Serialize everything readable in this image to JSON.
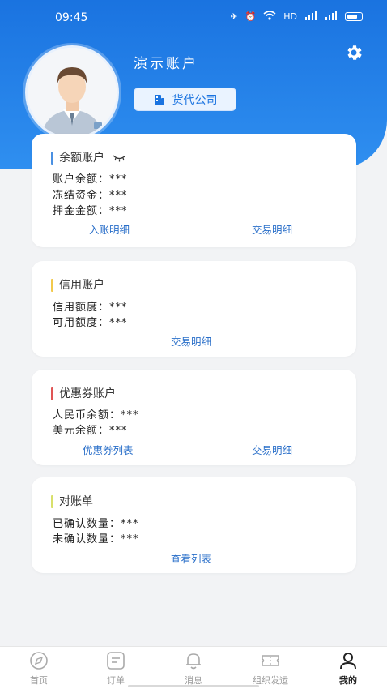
{
  "status_bar": {
    "time": "09:45",
    "net_label": "HD",
    "signal1": "4G",
    "signal2": "4G"
  },
  "profile": {
    "account_name": "演示账户",
    "company_label": "货代公司"
  },
  "balance_card": {
    "title": "余额账户",
    "rows": [
      {
        "label": "账户余额：",
        "value": "***"
      },
      {
        "label": "冻结资金：",
        "value": "***"
      },
      {
        "label": "押金金额：",
        "value": "***"
      }
    ],
    "links": [
      "入账明细",
      "交易明细"
    ]
  },
  "credit_card": {
    "title": "信用账户",
    "rows": [
      {
        "label": "信用额度：",
        "value": "***"
      },
      {
        "label": "可用额度：",
        "value": "***"
      }
    ],
    "links": [
      "交易明细"
    ]
  },
  "coupon_card": {
    "title": "优惠券账户",
    "rows": [
      {
        "label": "人民币余额：",
        "value": "***"
      },
      {
        "label": "美元余额：",
        "value": "***"
      }
    ],
    "links": [
      "优惠券列表",
      "交易明细"
    ]
  },
  "statement_card": {
    "title": "对账单",
    "rows": [
      {
        "label": "已确认数量：",
        "value": "***"
      },
      {
        "label": "未确认数量：",
        "value": "***"
      }
    ],
    "links": [
      "查看列表"
    ]
  },
  "tabbar": {
    "items": [
      {
        "label": "首页",
        "icon": "compass-icon"
      },
      {
        "label": "订单",
        "icon": "order-icon"
      },
      {
        "label": "消息",
        "icon": "bell-icon"
      },
      {
        "label": "组织发运",
        "icon": "ticket-icon"
      },
      {
        "label": "我的",
        "icon": "user-icon"
      }
    ],
    "active": "我的"
  },
  "colors": {
    "primary": "#1a73e0",
    "link": "#2a6fc9",
    "background": "#f2f3f5"
  }
}
